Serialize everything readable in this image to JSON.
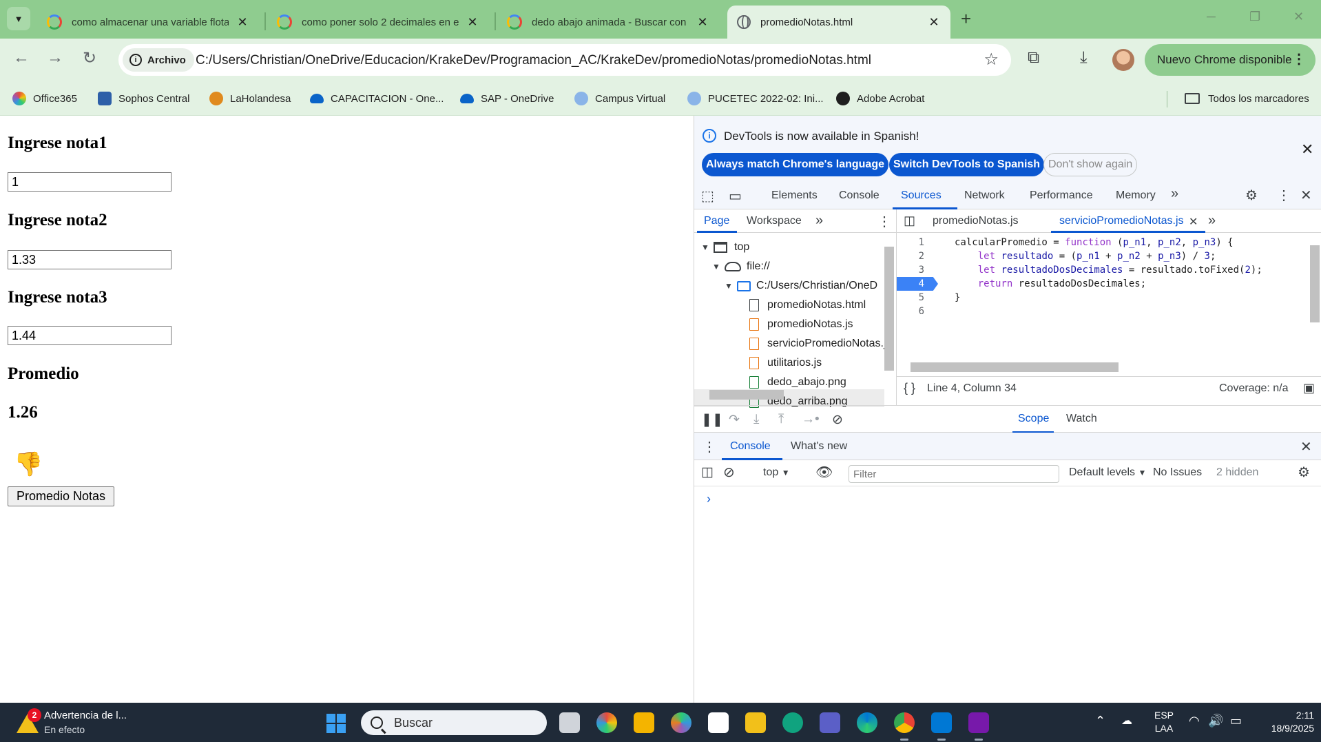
{
  "browser": {
    "tabs": [
      {
        "title": "como almacenar una variable flota",
        "icon": "google-icon"
      },
      {
        "title": "como poner solo 2 decimales en e",
        "icon": "google-icon"
      },
      {
        "title": "dedo abajo animada - Buscar con",
        "icon": "google-icon"
      },
      {
        "title": "promedioNotas.html",
        "icon": "globe-icon",
        "active": true
      }
    ],
    "new_tab": "+",
    "chip_label": "Archivo",
    "url": "C:/Users/Christian/OneDrive/Educacion/KrakeDev/Programacion_AC/KrakeDev/promedioNotas/promedioNotas.html",
    "update_label": "Nuevo Chrome disponible",
    "bookmarks": [
      "Office365",
      "Sophos Central",
      "LaHolandesa",
      "CAPACITACION - One...",
      "SAP - OneDrive",
      "Campus Virtual",
      "PUCETEC 2022-02: Ini...",
      "Adobe Acrobat"
    ],
    "all_bookmarks": "Todos los marcadores"
  },
  "page": {
    "label1": "Ingrese nota1",
    "value1": "1",
    "label2": "Ingrese nota2",
    "value2": "1.33",
    "label3": "Ingrese nota3",
    "value3": "1.44",
    "result_label": "Promedio",
    "result_value": "1.26",
    "thumb": "👎",
    "button": "Promedio Notas"
  },
  "devtools": {
    "info_text": "DevTools is now available in Spanish!",
    "btn_match": "Always match Chrome's language",
    "btn_switch": "Switch DevTools to Spanish",
    "btn_dismiss": "Don't show again",
    "tabs": [
      "Elements",
      "Console",
      "Sources",
      "Network",
      "Performance",
      "Memory"
    ],
    "more": "»",
    "nav_tabs": [
      "Page",
      "Workspace"
    ],
    "tree": {
      "top": "top",
      "origin": "file://",
      "folder": "C:/Users/Christian/OneD",
      "files": [
        "promedioNotas.html",
        "promedioNotas.js",
        "servicioPromedioNotas.js",
        "utilitarios.js",
        "dedo_abajo.png",
        "dedo_arriba.png"
      ]
    },
    "editor_tabs": [
      "promedioNotas.js",
      "servicioPromedioNotas.js"
    ],
    "line_numbers": [
      "1",
      "2",
      "3",
      "4",
      "5",
      "6"
    ],
    "status": "Line 4, Column 34",
    "coverage": "Coverage: n/a",
    "scope_tabs": [
      "Scope",
      "Watch"
    ],
    "console_tabs": [
      "Console",
      "What's new"
    ],
    "context": "top",
    "filter_placeholder": "Filter",
    "levels": "Default levels",
    "issues": "No Issues",
    "hidden": "2 hidden"
  },
  "taskbar": {
    "weather_badge": "2",
    "weather_title": "Advertencia de l...",
    "weather_sub": "En efecto",
    "search_placeholder": "Buscar",
    "lang_top": "ESP",
    "lang_bottom": "LAA",
    "time": "2:11",
    "date": "18/9/2025"
  }
}
